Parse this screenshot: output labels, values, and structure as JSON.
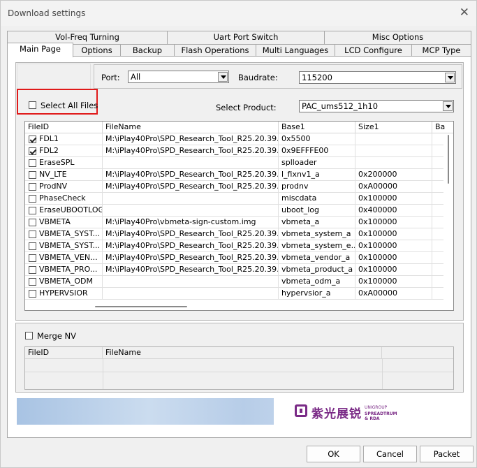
{
  "window": {
    "title": "Download settings",
    "close_glyph": "✕"
  },
  "tabs_row1": [
    "Vol-Freq Turning",
    "Uart Port Switch",
    "Misc Options"
  ],
  "tabs_row2": [
    "Main Page",
    "Options",
    "Backup",
    "Flash Operations",
    "Multi Languages",
    "LCD Configure",
    "MCP Type"
  ],
  "active_tab": "Main Page",
  "port": {
    "label": "Port:",
    "value": "All"
  },
  "baudrate": {
    "label": "Baudrate:",
    "value": "115200"
  },
  "select_all": {
    "label": "Select All Files",
    "checked": false
  },
  "select_product": {
    "label": "Select Product:",
    "value": "PAC_ums512_1h10"
  },
  "file_table": {
    "columns": [
      "FileID",
      "FileName",
      "Base1",
      "Size1",
      "Ba"
    ],
    "rows": [
      {
        "checked": true,
        "id": "FDL1",
        "name": "M:\\iPlay40Pro\\SPD_Research_Tool_R25.20.39...",
        "base": "0x5500",
        "size": ""
      },
      {
        "checked": true,
        "id": "FDL2",
        "name": "M:\\iPlay40Pro\\SPD_Research_Tool_R25.20.39...",
        "base": "0x9EFFFE00",
        "size": ""
      },
      {
        "checked": false,
        "id": "EraseSPL",
        "name": "",
        "base": "splloader",
        "size": ""
      },
      {
        "checked": false,
        "id": "NV_LTE",
        "name": "M:\\iPlay40Pro\\SPD_Research_Tool_R25.20.39...",
        "base": "l_fixnv1_a",
        "size": "0x200000"
      },
      {
        "checked": false,
        "id": "ProdNV",
        "name": "M:\\iPlay40Pro\\SPD_Research_Tool_R25.20.39...",
        "base": "prodnv",
        "size": "0xA00000"
      },
      {
        "checked": false,
        "id": "PhaseCheck",
        "name": "",
        "base": "miscdata",
        "size": "0x100000"
      },
      {
        "checked": false,
        "id": "EraseUBOOTLOG",
        "name": "",
        "base": "uboot_log",
        "size": "0x400000"
      },
      {
        "checked": false,
        "id": "VBMETA",
        "name": "M:\\iPlay40Pro\\vbmeta-sign-custom.img",
        "base": "vbmeta_a",
        "size": "0x100000"
      },
      {
        "checked": false,
        "id": "VBMETA_SYST...",
        "name": "M:\\iPlay40Pro\\SPD_Research_Tool_R25.20.39...",
        "base": "vbmeta_system_a",
        "size": "0x100000"
      },
      {
        "checked": false,
        "id": "VBMETA_SYST...",
        "name": "M:\\iPlay40Pro\\SPD_Research_Tool_R25.20.39...",
        "base": "vbmeta_system_e...",
        "size": "0x100000"
      },
      {
        "checked": false,
        "id": "VBMETA_VEN...",
        "name": "M:\\iPlay40Pro\\SPD_Research_Tool_R25.20.39...",
        "base": "vbmeta_vendor_a",
        "size": "0x100000"
      },
      {
        "checked": false,
        "id": "VBMETA_PRO...",
        "name": "M:\\iPlay40Pro\\SPD_Research_Tool_R25.20.39...",
        "base": "vbmeta_product_a",
        "size": "0x100000"
      },
      {
        "checked": false,
        "id": "VBMETA_ODM",
        "name": "",
        "base": "vbmeta_odm_a",
        "size": "0x100000"
      },
      {
        "checked": false,
        "id": "HYPERVSIOR",
        "name": "",
        "base": "hypervsior_a",
        "size": "0xA00000"
      }
    ]
  },
  "merge_nv": {
    "label": "Merge NV",
    "checked": false
  },
  "merge_table": {
    "columns": [
      "FileID",
      "FileName"
    ]
  },
  "banner": {
    "logo_cn": "紫光展锐",
    "logo_en1": "UNIGROUP",
    "logo_en2": "SPREADTRUM & RDA"
  },
  "buttons": {
    "ok": "OK",
    "cancel": "Cancel",
    "packet": "Packet"
  },
  "colors": {
    "highlight_box": "#e01a1a",
    "logo": "#7a2a86"
  }
}
